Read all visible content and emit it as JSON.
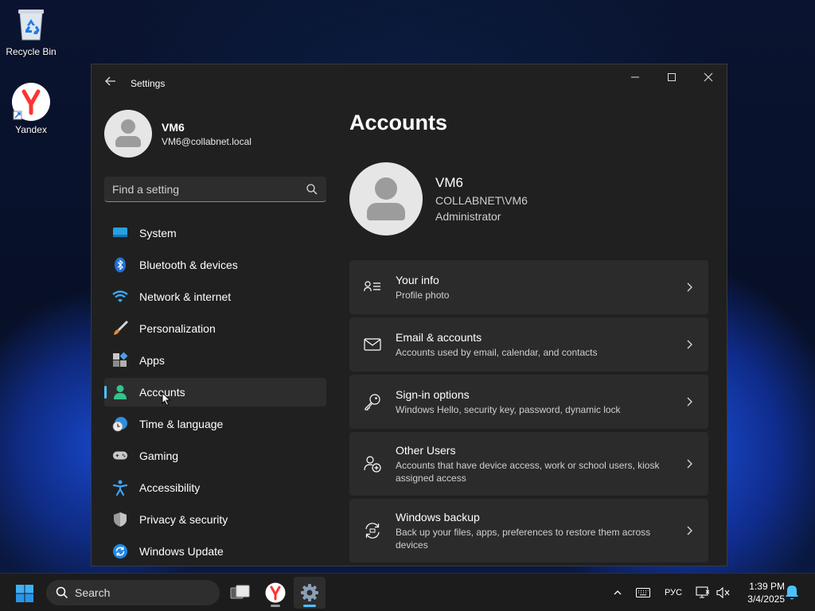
{
  "desktop": {
    "icons": [
      {
        "label": "Recycle Bin",
        "icon": "recycle-bin-icon"
      },
      {
        "label": "Yandex",
        "icon": "yandex-icon"
      }
    ]
  },
  "window": {
    "title": "Settings",
    "controls": {
      "minimize": "minimize-icon",
      "maximize": "maximize-icon",
      "close": "close-icon"
    }
  },
  "profile": {
    "name": "VM6",
    "email": "VM6@collabnet.local"
  },
  "search": {
    "placeholder": "Find a setting"
  },
  "nav": {
    "items": [
      {
        "label": "System",
        "icon": "system-icon"
      },
      {
        "label": "Bluetooth & devices",
        "icon": "bluetooth-icon"
      },
      {
        "label": "Network & internet",
        "icon": "wifi-icon"
      },
      {
        "label": "Personalization",
        "icon": "brush-icon"
      },
      {
        "label": "Apps",
        "icon": "apps-icon"
      },
      {
        "label": "Accounts",
        "icon": "accounts-icon",
        "active": true
      },
      {
        "label": "Time & language",
        "icon": "clock-globe-icon"
      },
      {
        "label": "Gaming",
        "icon": "gamepad-icon"
      },
      {
        "label": "Accessibility",
        "icon": "accessibility-icon"
      },
      {
        "label": "Privacy & security",
        "icon": "shield-icon"
      },
      {
        "label": "Windows Update",
        "icon": "update-icon"
      }
    ]
  },
  "main": {
    "title": "Accounts",
    "user": {
      "name": "VM6",
      "domain": "COLLABNET\\VM6",
      "role": "Administrator"
    },
    "cards": [
      {
        "title": "Your info",
        "subtitle": "Profile photo",
        "icon": "user-info-icon"
      },
      {
        "title": "Email & accounts",
        "subtitle": "Accounts used by email, calendar, and contacts",
        "icon": "mail-icon"
      },
      {
        "title": "Sign-in options",
        "subtitle": "Windows Hello, security key, password, dynamic lock",
        "icon": "key-icon"
      },
      {
        "title": "Other Users",
        "subtitle": "Accounts that have device access, work or school users, kiosk assigned access",
        "icon": "add-user-icon"
      },
      {
        "title": "Windows backup",
        "subtitle": "Back up your files, apps, preferences to restore them across devices",
        "icon": "backup-icon"
      }
    ]
  },
  "taskbar": {
    "search_label": "Search",
    "language": "РУС",
    "time": "1:39 PM",
    "date": "3/4/2025"
  },
  "colors": {
    "accent": "#4cc2ff",
    "window_bg": "#202020",
    "card_bg": "#2b2b2b"
  }
}
